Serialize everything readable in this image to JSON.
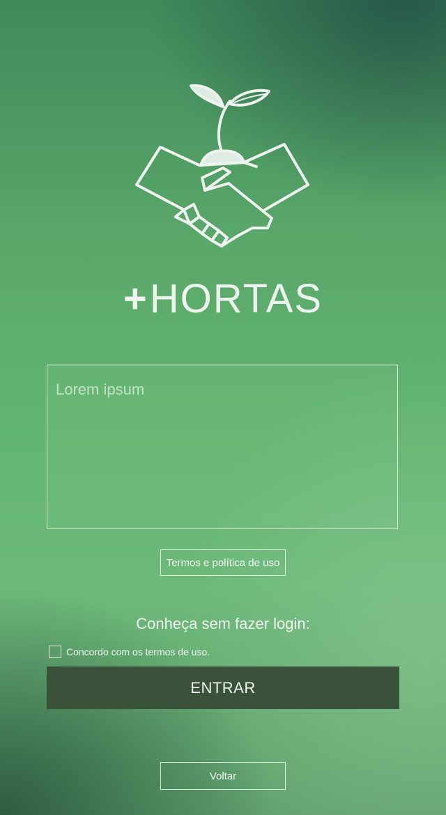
{
  "app": {
    "brand_plus": "+",
    "brand_name": "HORTAS"
  },
  "main": {
    "text_area_placeholder": "Lorem ipsum",
    "terms_button_label": "Termos e política de uso",
    "guest_title": "Conheça sem fazer login:",
    "agree_label": "Concordo com os termos de uso.",
    "agree_checked": false,
    "enter_button_label": "ENTRAR",
    "back_button_label": "Voltar"
  },
  "icons": {
    "logo": "handshake-sprout-icon",
    "checkbox": "checkbox-empty-icon"
  },
  "colors": {
    "enter_button_bg": "#3a5239",
    "text": "#eef5ef"
  }
}
